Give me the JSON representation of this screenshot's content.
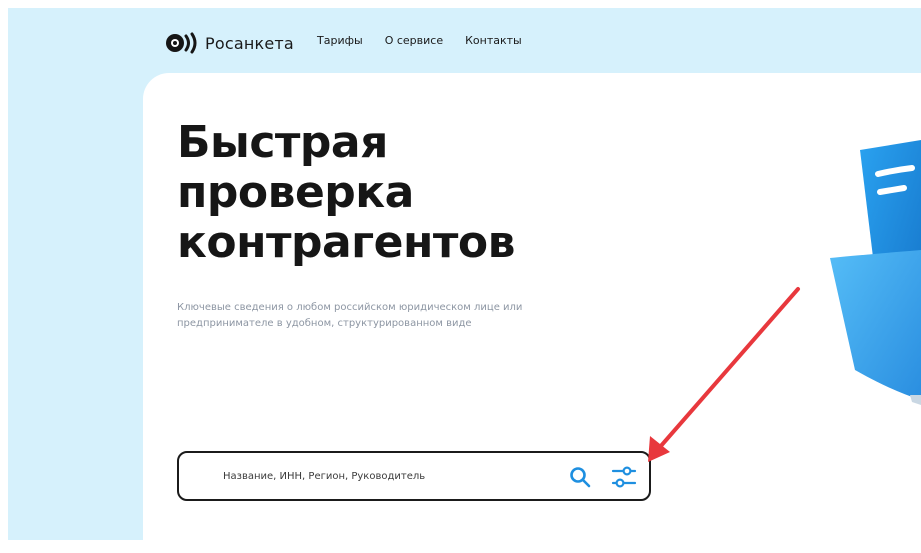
{
  "brand": {
    "name": "Росанкета"
  },
  "nav": [
    {
      "label": "Тарифы"
    },
    {
      "label": "О сервисе"
    },
    {
      "label": "Контакты"
    }
  ],
  "hero": {
    "title_lines": [
      "Быстрая",
      "проверка",
      "контрагентов"
    ],
    "subtitle": "Ключевые сведения о любом российском юридическом лице или предпринимателе в удобном, структурированном виде"
  },
  "search": {
    "placeholder": "Название, ИНН, Регион, Руководитель",
    "value": ""
  },
  "icons": {
    "logo": "logo-icon",
    "search": "search-icon",
    "filter": "filter-sliders-icon",
    "illustration": "folder-icon"
  },
  "colors": {
    "page_bg": "#d6f1fc",
    "accent": "#1e8fe0",
    "annotation_arrow": "#e8383d"
  }
}
